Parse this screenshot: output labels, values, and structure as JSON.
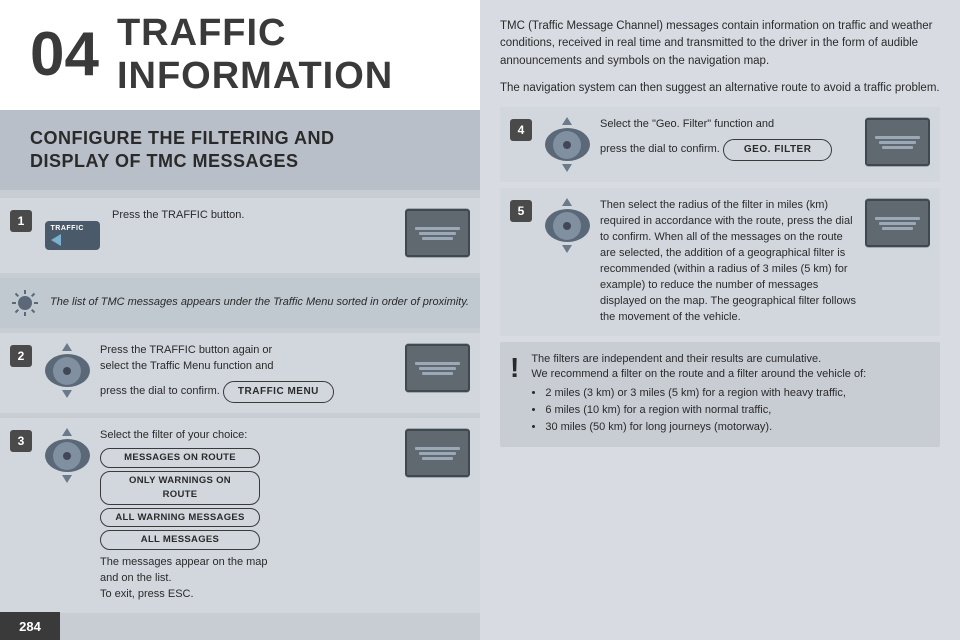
{
  "header": {
    "number": "04",
    "title": "TRAFFIC INFORMATION"
  },
  "sub_header": {
    "line1": "CONFIGURE THE FILTERING AND",
    "line2": "DISPLAY OF TMC MESSAGES"
  },
  "right_description": {
    "para1": "TMC (Traffic Message Channel) messages contain information on traffic and weather conditions, received in real time and transmitted to the driver in the form of audible announcements and symbols on the navigation map.",
    "para2": "The navigation system can then suggest an alternative route to avoid a traffic problem."
  },
  "steps": {
    "step1": {
      "num": "1",
      "icon": "traffic-button-icon",
      "text": "Press the TRAFFIC button."
    },
    "info_row": {
      "text": "The list of TMC messages appears under the Traffic Menu sorted in order of proximity."
    },
    "step2": {
      "num": "2",
      "text_line1": "Press the TRAFFIC button again or",
      "text_line2": "select the Traffic Menu function and",
      "text_line3": "press the dial to confirm.",
      "menu_btn": "TRAFFIC MENU"
    },
    "step3": {
      "num": "3",
      "intro": "Select the filter of your choice:",
      "filters": [
        "MESSAGES ON ROUTE",
        "ONLY WARNINGS ON ROUTE",
        "ALL WARNING MESSAGES",
        "ALL MESSAGES"
      ],
      "footer_line1": "The messages appear on the map",
      "footer_line2": "and on the list.",
      "footer_line3": "To exit, press ESC."
    }
  },
  "right_steps": {
    "step4": {
      "num": "4",
      "text_line1": "Select the \"Geo. Filter\" function and",
      "text_line2": "press the dial to confirm.",
      "geo_btn": "GEO. FILTER"
    },
    "step5": {
      "num": "5",
      "text": "Then select the radius of the filter in miles (km) required in accordance with the route, press the dial to confirm. When all of the messages on the route are selected, the addition of a geographical filter is recommended (within a radius of 3 miles (5 km) for example) to reduce the number of messages displayed on the map. The geographical filter follows the movement of the vehicle."
    },
    "warning": {
      "symbol": "!",
      "line1": "The filters are independent and their results are cumulative.",
      "line2": "We recommend a filter on the route and a filter around the vehicle of:",
      "items": [
        "2 miles (3 km) or 3 miles (5 km) for a region with heavy traffic,",
        "6 miles (10 km) for a region with normal traffic,",
        "30 miles (50 km) for long journeys (motorway)."
      ]
    }
  },
  "page_num": "284"
}
